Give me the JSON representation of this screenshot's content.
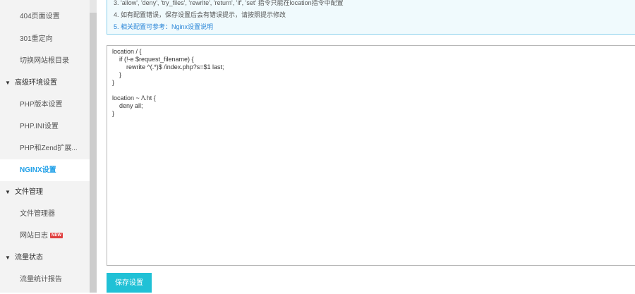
{
  "sidebar": {
    "items": [
      {
        "label": "404页面设置"
      },
      {
        "label": "301重定向"
      },
      {
        "label": "切换网站根目录"
      },
      {
        "label": "高级环境设置"
      },
      {
        "label": "PHP版本设置"
      },
      {
        "label": "PHP.INI设置"
      },
      {
        "label": "PHP和Zend扩展..."
      },
      {
        "label": "NGINX设置"
      },
      {
        "label": "文件管理"
      },
      {
        "label": "文件管理器"
      },
      {
        "label": "网站日志",
        "badge": "NEW"
      },
      {
        "label": "流量状态"
      },
      {
        "label": "流量统计报告"
      }
    ],
    "active": "NGINX设置"
  },
  "tips": {
    "line3": "3. 'allow', 'deny', 'try_files', 'rewrite', 'return', 'if', 'set' 指令只能在location指令中配置",
    "line4": "4. 如有配置错误，保存设置后会有错误提示，请按照提示修改",
    "line5": "5. 相关配置可参考：Nginx设置说明"
  },
  "editor": {
    "content": "location / {\n    if (!-e $request_filename) {\n        rewrite ^(.*)$ /index.php?s=$1 last;\n    }\n}\n\nlocation ~ /\\.ht {\n    deny all;\n}"
  },
  "actions": {
    "save_label": "保存设置"
  },
  "colors": {
    "accent": "#20a0e8",
    "button": "#20c1d6",
    "badge": "#e03e3e",
    "info_border": "#8bd0ec"
  }
}
